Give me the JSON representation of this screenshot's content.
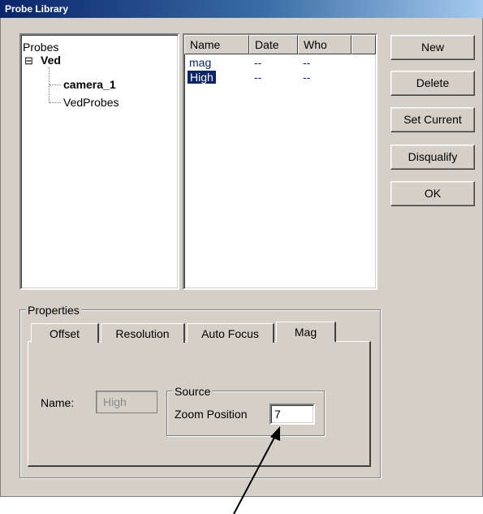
{
  "window": {
    "title": "Probe Library"
  },
  "tree": {
    "header": "Probes",
    "expander": "⊟",
    "root": "Ved",
    "children": [
      "camera_1",
      "VedProbes"
    ]
  },
  "list": {
    "columns": [
      "Name",
      "Date",
      "Who"
    ],
    "rows": [
      {
        "name": "mag",
        "date": "--",
        "who": "--",
        "selected": false
      },
      {
        "name": "High",
        "date": "--",
        "who": "--",
        "selected": true
      }
    ]
  },
  "buttons": {
    "new": "New",
    "delete": "Delete",
    "set_current": "Set Current",
    "disqualify": "Disqualify",
    "ok": "OK"
  },
  "properties": {
    "label": "Properties",
    "tabs": [
      "Offset",
      "Resolution",
      "Auto Focus",
      "Mag"
    ],
    "active_tab": "Mag",
    "name_label": "Name:",
    "name_value": "High",
    "source_label": "Source",
    "zoom_label": "Zoom Position",
    "zoom_value": "7"
  },
  "colors": {
    "selection": "#0a246a",
    "link_text": "#0a246a",
    "window_bg": "#d4d0c8"
  }
}
